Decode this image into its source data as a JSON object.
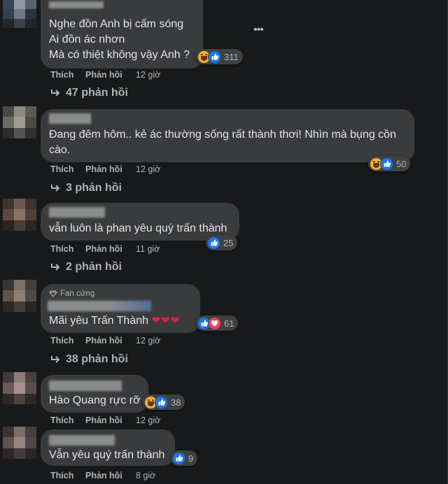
{
  "labels": {
    "like": "Thích",
    "reply": "Phản hồi"
  },
  "comments": [
    {
      "lines": [
        "Nghe đồn Anh bị cấm sóng",
        "Ai đồn ác nhơn",
        "Mà có thiệt không vậy Anh ?"
      ],
      "reactions": [
        "haha",
        "like"
      ],
      "count": "311",
      "time": "12 giờ",
      "replies": "47 phản hồi",
      "more_icon": "more-options-icon"
    },
    {
      "lines": [
        "Đang đêm hôm.. kẻ ác thường sống rất thành thơi! Nhìn mà bụng cồn",
        "cào."
      ],
      "reactions": [
        "haha",
        "like"
      ],
      "count": "50",
      "time": "12 giờ",
      "replies": "3 phản hồi"
    },
    {
      "lines": [
        "vẫn luôn là phan yêu quý trấn thành"
      ],
      "reactions": [
        "like"
      ],
      "count": "25",
      "time": "11 giờ",
      "replies": "2 phản hồi"
    },
    {
      "badge": "Fan cứng",
      "lines": [
        "Mãi yêu Trấn Thành"
      ],
      "hearts": "❤❤❤",
      "reactions": [
        "like",
        "love"
      ],
      "count": "61",
      "time": "12 giờ",
      "replies": "38 phản hồi"
    },
    {
      "lines": [
        "Hào Quang rực rỡ"
      ],
      "reactions": [
        "haha",
        "like"
      ],
      "count": "38",
      "time": "12 giờ"
    },
    {
      "lines": [
        "Vẫn yêu quý trấn thành"
      ],
      "reactions": [
        "like"
      ],
      "count": "9",
      "time": "8 giờ"
    }
  ]
}
